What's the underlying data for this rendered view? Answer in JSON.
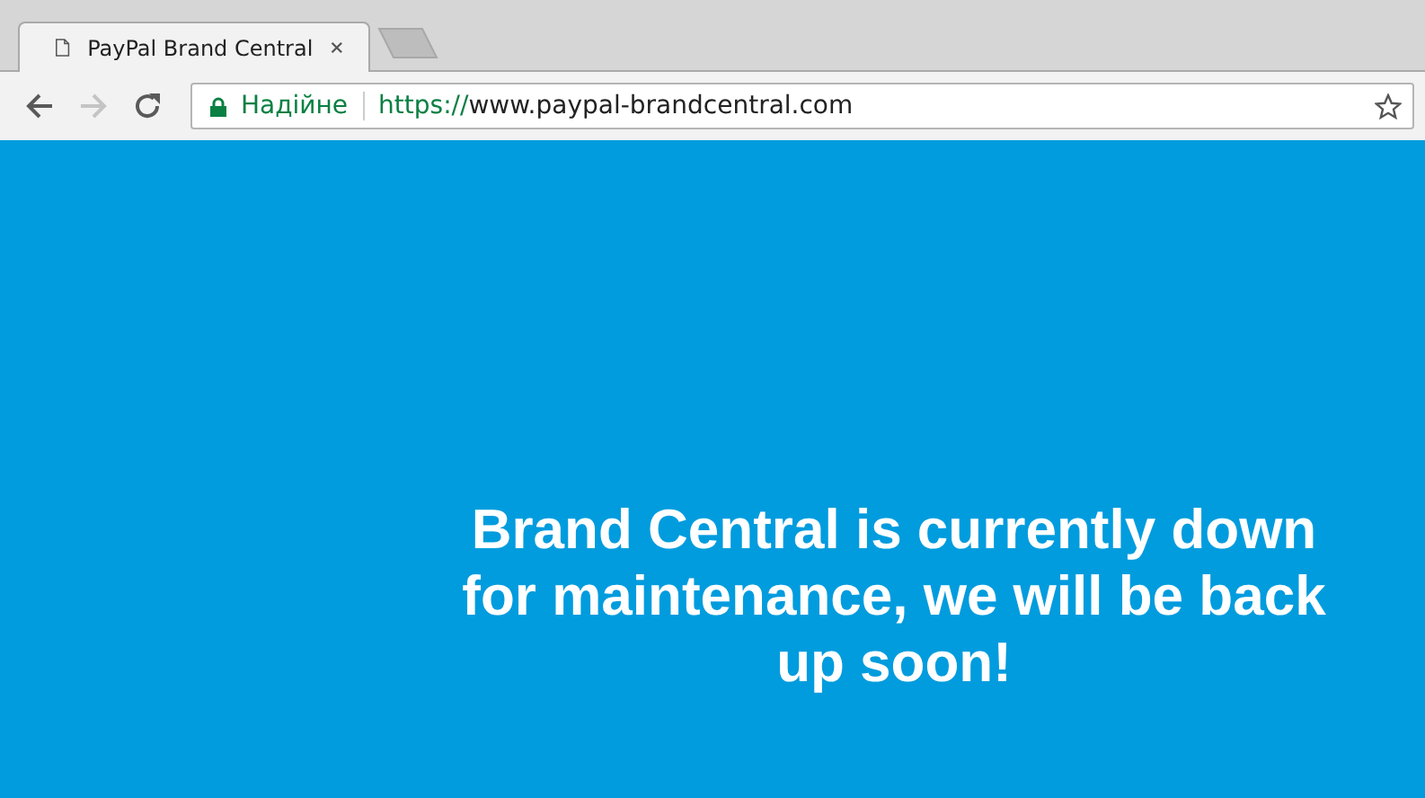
{
  "tabs": [
    {
      "title": "PayPal Brand Central",
      "selected": true
    }
  ],
  "nav": {
    "back": {
      "disabled": false
    },
    "forward": {
      "disabled": true
    }
  },
  "address": {
    "security_label": "Надійне",
    "scheme": "https://",
    "rest": "www.paypal-brandcentral.com",
    "bookmarked": false
  },
  "page": {
    "message": "Brand Central is currently down for maintenance, we will be back up soon!"
  }
}
